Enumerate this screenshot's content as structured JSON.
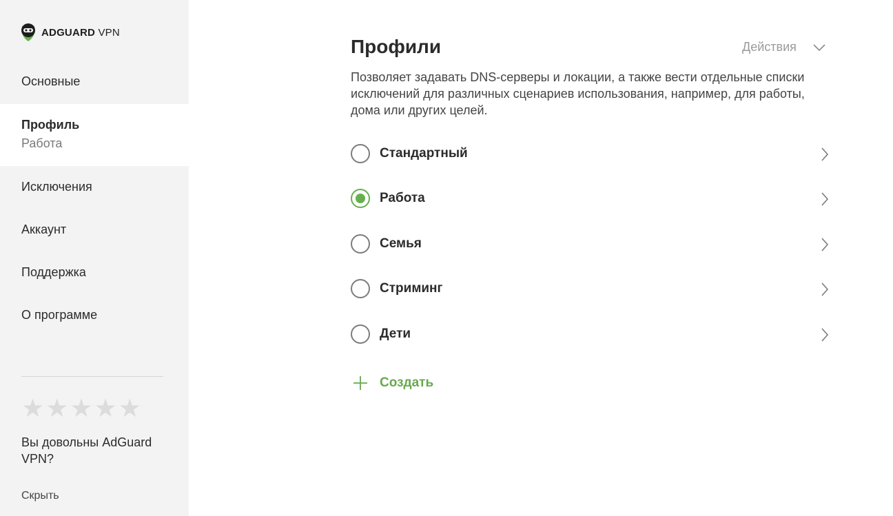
{
  "app": {
    "logo_bold": "ADGUARD",
    "logo_light": " VPN"
  },
  "sidebar": {
    "items": [
      {
        "label": "Основные"
      },
      {
        "label": "Профиль",
        "sub": "Работа"
      },
      {
        "label": "Исключения"
      },
      {
        "label": "Аккаунт"
      },
      {
        "label": "Поддержка"
      },
      {
        "label": "О программе"
      }
    ],
    "rating": {
      "stars": [
        "★",
        "★",
        "★",
        "★",
        "★"
      ],
      "question": "Вы довольны AdGuard VPN?",
      "hide": "Скрыть"
    }
  },
  "main": {
    "title": "Профили",
    "actions_label": "Действия",
    "description": "Позволяет задавать DNS-серверы и локации, а также вести отдельные списки исключений для различных сценариев использования, например, для работы, дома или других целей.",
    "profiles": [
      {
        "name": "Стандартный",
        "selected": false
      },
      {
        "name": "Работа",
        "selected": true
      },
      {
        "name": "Семья",
        "selected": false
      },
      {
        "name": "Стриминг",
        "selected": false
      },
      {
        "name": "Дети",
        "selected": false
      }
    ],
    "create_label": "Создать"
  },
  "colors": {
    "accent": "#67b04e",
    "sidebar_bg": "#f3f3f3",
    "muted": "#9a9a9a"
  }
}
